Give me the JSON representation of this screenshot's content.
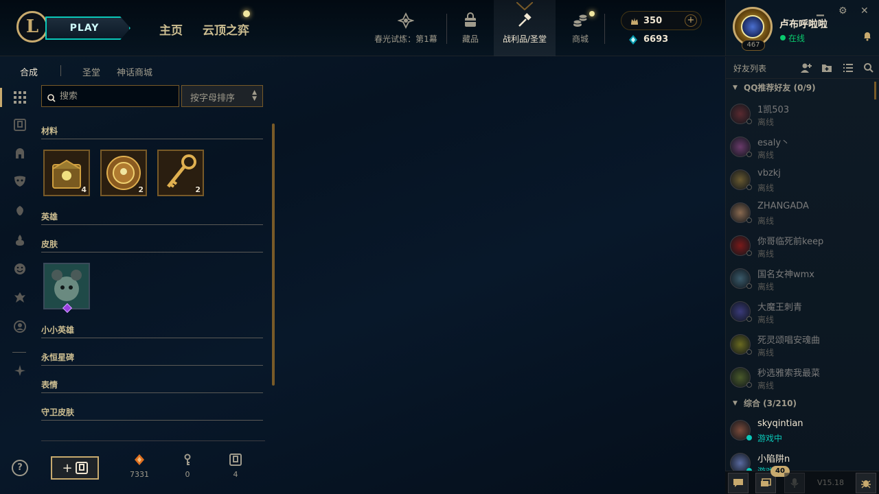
{
  "topbar": {
    "logo_letter": "L",
    "play_label": "PLAY",
    "nav_home": "主页",
    "nav_tft": "云顶之弈",
    "nav_items": [
      {
        "label": "春光试炼：第1幕",
        "icon": "trial-crest-icon"
      },
      {
        "label": "藏品",
        "icon": "collection-bag-icon"
      },
      {
        "label": "战利品/圣堂",
        "icon": "loot-hammer-icon"
      },
      {
        "label": "商城",
        "icon": "store-coins-icon"
      }
    ],
    "rp": "350",
    "rp_plus": "+",
    "blue_essence": "6693"
  },
  "profile": {
    "name": "卢布呼啦啦",
    "status": "在线",
    "level": "467",
    "window_buttons": {
      "minimize": "▁",
      "settings": "⚙",
      "close": "✕"
    }
  },
  "loot": {
    "tabs": [
      "合成",
      "圣堂",
      "神话商城"
    ],
    "search_placeholder": "搜索",
    "sort_label": "按字母排序",
    "sections": {
      "materials": "材料",
      "champions": "英雄",
      "skins": "皮肤",
      "little_legends": "小小英雄",
      "eternals": "永恒星碑",
      "emotes": "表情",
      "ward_skins": "守卫皮肤"
    },
    "material_items": [
      {
        "name": "hextech-chest",
        "count": "4"
      },
      {
        "name": "orb",
        "count": "2"
      },
      {
        "name": "key",
        "count": "2"
      }
    ],
    "resources": [
      {
        "icon": "orange-essence-icon",
        "value": "7331"
      },
      {
        "icon": "key-fragment-icon",
        "value": "0"
      },
      {
        "icon": "chest-icon",
        "value": "4"
      }
    ],
    "craft_plus": "+",
    "help": "?"
  },
  "friends": {
    "title": "好友列表",
    "groups": [
      {
        "label": "QQ推荐好友 (0/9)"
      },
      {
        "label": "综合 (3/210)"
      }
    ],
    "qq_friends": [
      {
        "name": "1凯503",
        "status": "离线",
        "color": "#5a2a30"
      },
      {
        "name": "esaly丶",
        "status": "离线",
        "color": "#6a3a6a"
      },
      {
        "name": "vbzkj",
        "status": "离线",
        "color": "#6a5a30"
      },
      {
        "name": "ZHANGADA",
        "status": "离线",
        "color": "#8a6a50"
      },
      {
        "name": "你哥临死前keep",
        "status": "离线",
        "color": "#7a1a1a"
      },
      {
        "name": "国名女神wmx",
        "status": "离线",
        "color": "#3a5a6a"
      },
      {
        "name": "大魔王刺青",
        "status": "离线",
        "color": "#3a3a7a"
      },
      {
        "name": "死灵颂唱安魂曲",
        "status": "离线",
        "color": "#6a6a20"
      },
      {
        "name": "秒选雅索我最菜",
        "status": "离线",
        "color": "#4a5a2a"
      }
    ],
    "general_friends": [
      {
        "name": "skyqintian",
        "status": "游戏中",
        "color": "#7a4a3a"
      },
      {
        "name": "小陷阱n",
        "status": "游戏中",
        "color": "#5a6aa0"
      }
    ],
    "footer_badge": "40",
    "version": "V15.18"
  }
}
